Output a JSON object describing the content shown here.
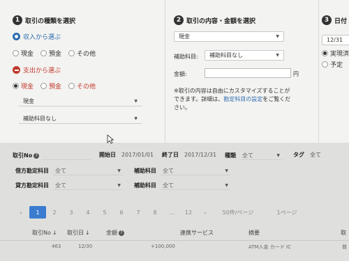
{
  "step1": {
    "num": "1",
    "title": "取引の種類を選択",
    "income_label": "収入から選ぶ",
    "income_options": [
      "現金",
      "預金",
      "その他"
    ],
    "expense_label": "支出から選ぶ",
    "expense_options": [
      "現金",
      "預金",
      "その他"
    ],
    "account_select": "現金",
    "sub_select": "補助科目なし"
  },
  "step2": {
    "num": "2",
    "title": "取引の内容・金額を選択",
    "content_select": "現金",
    "sub_label": "補助科目:",
    "sub_select": "補助科目なし",
    "amount_label": "金額:",
    "amount_unit": "円",
    "note_a": "※取引の内容は自由にカスタマイズすることが",
    "note_b": "できます。詳細は、",
    "note_link": "勘定科目の設定",
    "note_c": "をご覧くだ",
    "note_d": "さい。"
  },
  "step3": {
    "num": "3",
    "title": "日付",
    "date_value": "12/31",
    "opt1": "実現済",
    "opt2": "予定"
  },
  "filter": {
    "txn_no_label": "取引No",
    "start_label": "開始日",
    "start_value": "2017/01/01",
    "end_label": "終了日",
    "end_value": "2017/12/31",
    "type_label": "種類",
    "type_value": "全て",
    "tag_label": "タグ",
    "tag_value": "全て",
    "debit_label": "借方勘定科目",
    "debit_value": "全て",
    "debit_sub_label": "補助科目",
    "debit_sub_value": "全て",
    "credit_label": "貸方勘定科目",
    "credit_value": "全て",
    "credit_sub_label": "補助科目",
    "credit_sub_value": "全て"
  },
  "pager": {
    "prev": "‹",
    "pages": [
      "1",
      "2",
      "3",
      "4",
      "5",
      "6",
      "7",
      "8"
    ],
    "ellipsis": "…",
    "last": "12",
    "next": "›",
    "per_page": "50件/ページ",
    "page_of": "1ページ"
  },
  "table": {
    "headers": [
      "取引No",
      "取引日",
      "金額",
      "連携サービス",
      "摘要",
      "取"
    ],
    "row": [
      "463",
      "12/30",
      "+100,000",
      "ATM入金 カード IC",
      "普"
    ]
  }
}
